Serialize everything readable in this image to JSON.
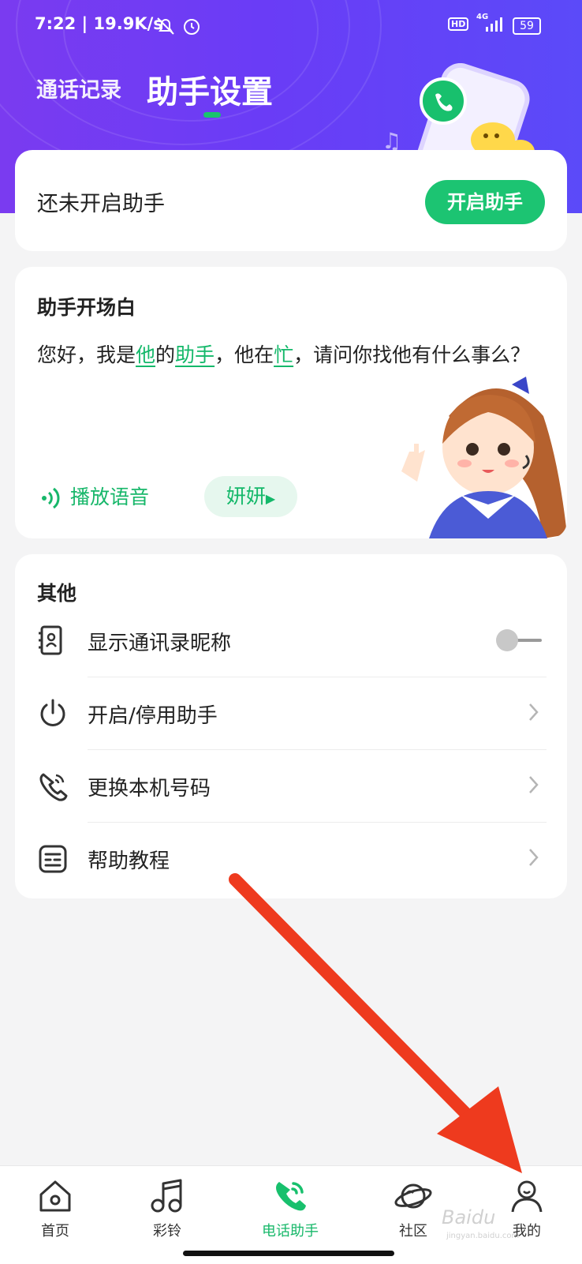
{
  "statusbar": {
    "time": "7:22",
    "speed": "19.9K/s",
    "net": "4G",
    "hd": "HD",
    "battery": "59"
  },
  "nav": {
    "tab_records": "通话记录",
    "tab_settings": "助手设置"
  },
  "status_card": {
    "label": "还未开启助手",
    "button": "开启助手"
  },
  "greeting_card": {
    "title": "助手开场白",
    "text_parts": [
      "您好，我是",
      "他",
      "的",
      "助手",
      "，他在",
      "忙",
      "，请问你找他有什么事么？"
    ],
    "play_label": "播放语音",
    "voice_name": "妍妍"
  },
  "other_card": {
    "title": "其他",
    "items": [
      {
        "label": "显示通讯录昵称",
        "icon": "contacts-icon",
        "control": "toggle",
        "toggle_on": false
      },
      {
        "label": "开启/停用助手",
        "icon": "power-icon",
        "control": "chevron"
      },
      {
        "label": "更换本机号码",
        "icon": "phone-icon",
        "control": "chevron"
      },
      {
        "label": "帮助教程",
        "icon": "help-doc-icon",
        "control": "chevron"
      }
    ]
  },
  "tabbar": {
    "items": [
      {
        "label": "首页",
        "icon": "home-icon",
        "active": false
      },
      {
        "label": "彩铃",
        "icon": "music-note-icon",
        "active": false
      },
      {
        "label": "电话助手",
        "icon": "phone-assistant-icon",
        "active": true
      },
      {
        "label": "社区",
        "icon": "planet-icon",
        "active": false
      },
      {
        "label": "我的",
        "icon": "person-icon",
        "active": false
      }
    ]
  },
  "watermark": {
    "brand": "Baidu",
    "url": "jingyan.baidu.com"
  },
  "colors": {
    "accent_green": "#1cc472",
    "header_purple": "#6a3cf6",
    "annotation_red": "#ee3a1e"
  }
}
